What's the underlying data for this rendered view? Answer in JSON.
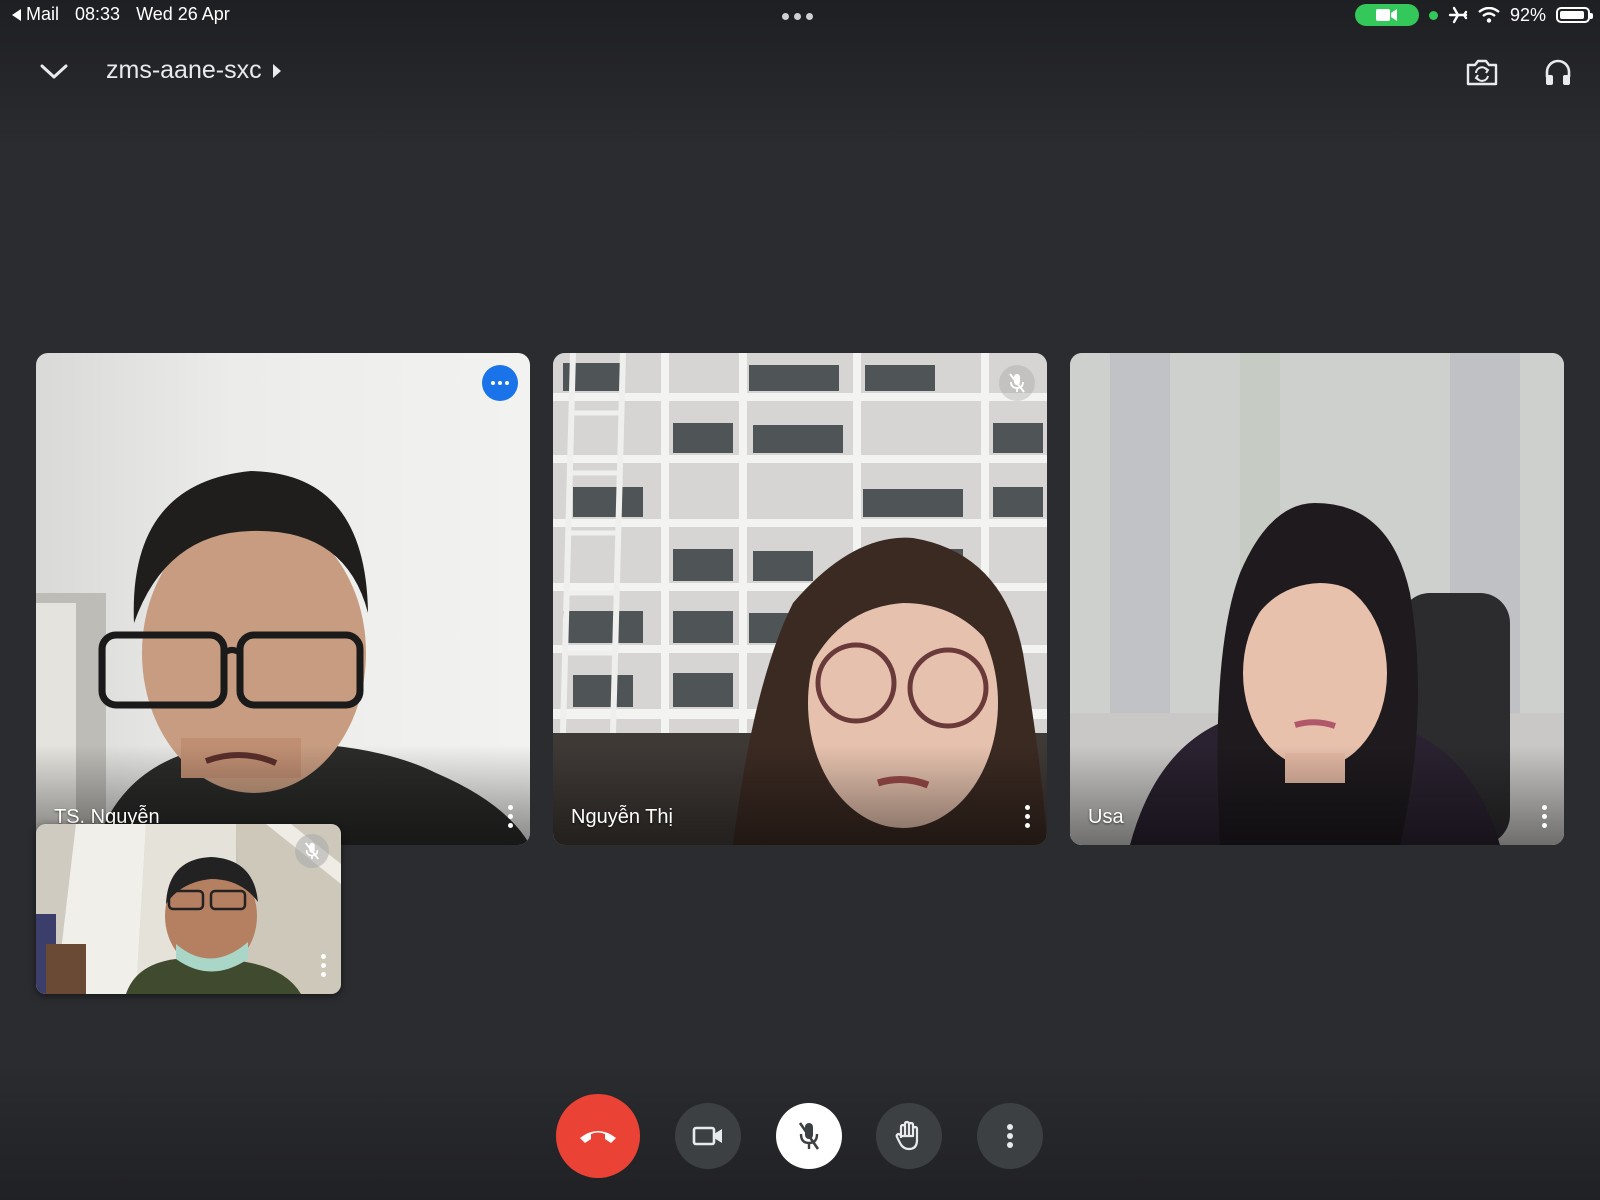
{
  "status_bar": {
    "back_app": "Mail",
    "time": "08:33",
    "date": "Wed 26 Apr",
    "battery": "92%"
  },
  "header": {
    "meeting_code": "zms-aane-sxc"
  },
  "participants": [
    {
      "name": "TS. Nguyễn",
      "muted": false,
      "speaking_badge": true
    },
    {
      "name": "Nguyễn Thị",
      "muted": true
    },
    {
      "name": "Usa",
      "muted": false
    }
  ],
  "self_view": {
    "muted": true
  },
  "controls": [
    "end-call",
    "camera",
    "microphone-muted",
    "raise-hand",
    "more-options"
  ],
  "colors": {
    "background": "#2b2c30",
    "hangup": "#ea4335",
    "control_gray": "#3c4043",
    "accent_blue": "#1a73e8",
    "status_green": "#34c759"
  }
}
